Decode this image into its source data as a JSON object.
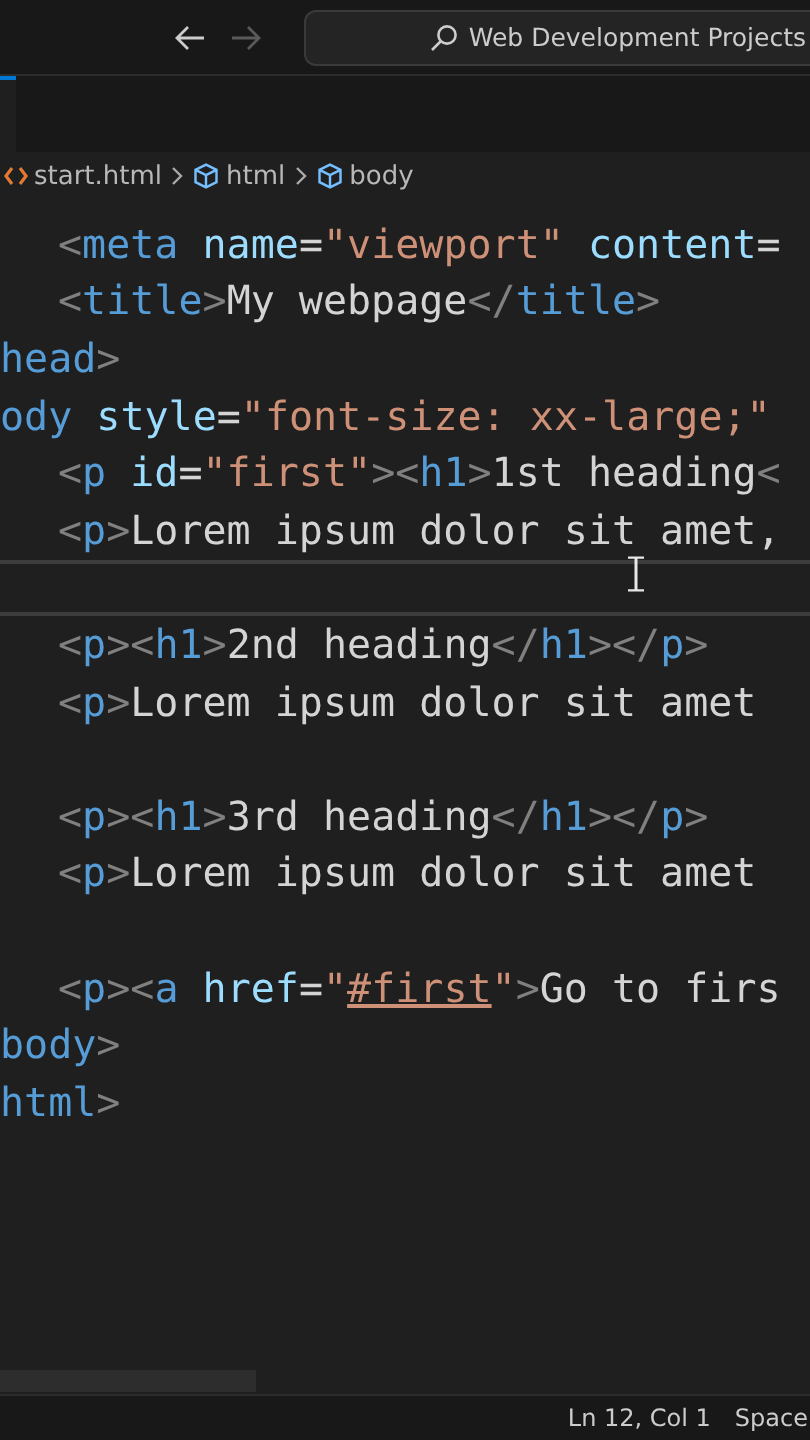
{
  "title_bar": {
    "back": {
      "disabled": false
    },
    "forward": {
      "disabled": true
    },
    "search": {
      "value": "Web Development Projects"
    }
  },
  "breadcrumb": [
    {
      "kind": "file",
      "label": "start.html"
    },
    {
      "kind": "symbol",
      "label": "html"
    },
    {
      "kind": "symbol",
      "label": "body"
    }
  ],
  "code_lines": [
    {
      "indented": true,
      "current": false,
      "tokens": [
        {
          "kind": "punct",
          "text": "<"
        },
        {
          "kind": "tag",
          "text": "meta"
        },
        {
          "kind": "attr",
          "text": " name"
        },
        {
          "kind": "text",
          "text": "="
        },
        {
          "kind": "string",
          "text": "\"viewport\""
        },
        {
          "kind": "attr",
          "text": " content"
        },
        {
          "kind": "text",
          "text": "="
        }
      ]
    },
    {
      "indented": true,
      "current": false,
      "tokens": [
        {
          "kind": "punct",
          "text": "<"
        },
        {
          "kind": "tag",
          "text": "title"
        },
        {
          "kind": "punct",
          "text": ">"
        },
        {
          "kind": "text",
          "text": "My webpage"
        },
        {
          "kind": "punct",
          "text": "</"
        },
        {
          "kind": "tag",
          "text": "title"
        },
        {
          "kind": "punct",
          "text": ">"
        }
      ]
    },
    {
      "indented": false,
      "current": false,
      "tokens": [
        {
          "kind": "tag",
          "text": "head"
        },
        {
          "kind": "punct",
          "text": ">"
        }
      ]
    },
    {
      "indented": false,
      "current": false,
      "tokens": [
        {
          "kind": "tag",
          "text": "ody"
        },
        {
          "kind": "attr",
          "text": " style"
        },
        {
          "kind": "text",
          "text": "="
        },
        {
          "kind": "string",
          "text": "\"font-size: xx-large;\""
        }
      ]
    },
    {
      "indented": true,
      "current": false,
      "tokens": [
        {
          "kind": "punct",
          "text": "<"
        },
        {
          "kind": "tag",
          "text": "p"
        },
        {
          "kind": "attr",
          "text": " id"
        },
        {
          "kind": "text",
          "text": "="
        },
        {
          "kind": "string",
          "text": "\"first\""
        },
        {
          "kind": "punct",
          "text": "><"
        },
        {
          "kind": "tag",
          "text": "h1"
        },
        {
          "kind": "punct",
          "text": ">"
        },
        {
          "kind": "text",
          "text": "1st heading"
        },
        {
          "kind": "punct",
          "text": "<"
        }
      ]
    },
    {
      "indented": true,
      "current": false,
      "tokens": [
        {
          "kind": "punct",
          "text": "<"
        },
        {
          "kind": "tag",
          "text": "p"
        },
        {
          "kind": "punct",
          "text": ">"
        },
        {
          "kind": "text",
          "text": "Lorem ipsum dolor sit amet,"
        }
      ]
    },
    {
      "current": true
    },
    {
      "indented": true,
      "current": false,
      "tokens": [
        {
          "kind": "punct",
          "text": "<"
        },
        {
          "kind": "tag",
          "text": "p"
        },
        {
          "kind": "punct",
          "text": "><"
        },
        {
          "kind": "tag",
          "text": "h1"
        },
        {
          "kind": "punct",
          "text": ">"
        },
        {
          "kind": "text",
          "text": "2nd heading"
        },
        {
          "kind": "punct",
          "text": "</"
        },
        {
          "kind": "tag",
          "text": "h1"
        },
        {
          "kind": "punct",
          "text": "></"
        },
        {
          "kind": "tag",
          "text": "p"
        },
        {
          "kind": "punct",
          "text": ">"
        }
      ]
    },
    {
      "indented": true,
      "current": false,
      "tokens": [
        {
          "kind": "punct",
          "text": "<"
        },
        {
          "kind": "tag",
          "text": "p"
        },
        {
          "kind": "punct",
          "text": ">"
        },
        {
          "kind": "text",
          "text": "Lorem ipsum dolor sit amet"
        }
      ]
    },
    {
      "current": false
    },
    {
      "indented": true,
      "current": false,
      "tokens": [
        {
          "kind": "punct",
          "text": "<"
        },
        {
          "kind": "tag",
          "text": "p"
        },
        {
          "kind": "punct",
          "text": "><"
        },
        {
          "kind": "tag",
          "text": "h1"
        },
        {
          "kind": "punct",
          "text": ">"
        },
        {
          "kind": "text",
          "text": "3rd heading"
        },
        {
          "kind": "punct",
          "text": "</"
        },
        {
          "kind": "tag",
          "text": "h1"
        },
        {
          "kind": "punct",
          "text": "></"
        },
        {
          "kind": "tag",
          "text": "p"
        },
        {
          "kind": "punct",
          "text": ">"
        }
      ]
    },
    {
      "indented": true,
      "current": false,
      "tokens": [
        {
          "kind": "punct",
          "text": "<"
        },
        {
          "kind": "tag",
          "text": "p"
        },
        {
          "kind": "punct",
          "text": ">"
        },
        {
          "kind": "text",
          "text": "Lorem ipsum dolor sit amet"
        }
      ]
    },
    {
      "current": false
    },
    {
      "indented": true,
      "current": false,
      "tokens": [
        {
          "kind": "punct",
          "text": "<"
        },
        {
          "kind": "tag",
          "text": "p"
        },
        {
          "kind": "punct",
          "text": "><"
        },
        {
          "kind": "tag",
          "text": "a"
        },
        {
          "kind": "attr",
          "text": " href"
        },
        {
          "kind": "text",
          "text": "="
        },
        {
          "kind": "string",
          "text": "\""
        },
        {
          "kind": "link",
          "text": "#first"
        },
        {
          "kind": "string",
          "text": "\""
        },
        {
          "kind": "punct",
          "text": ">"
        },
        {
          "kind": "text",
          "text": "Go to firs"
        }
      ]
    },
    {
      "indented": false,
      "current": false,
      "tokens": [
        {
          "kind": "tag",
          "text": "body"
        },
        {
          "kind": "punct",
          "text": ">"
        }
      ]
    },
    {
      "indented": false,
      "current": false,
      "tokens": [
        {
          "kind": "tag",
          "text": "html"
        },
        {
          "kind": "punct",
          "text": ">"
        }
      ]
    }
  ],
  "status_bar": [
    "Ln 12, Col 1",
    "Space"
  ]
}
